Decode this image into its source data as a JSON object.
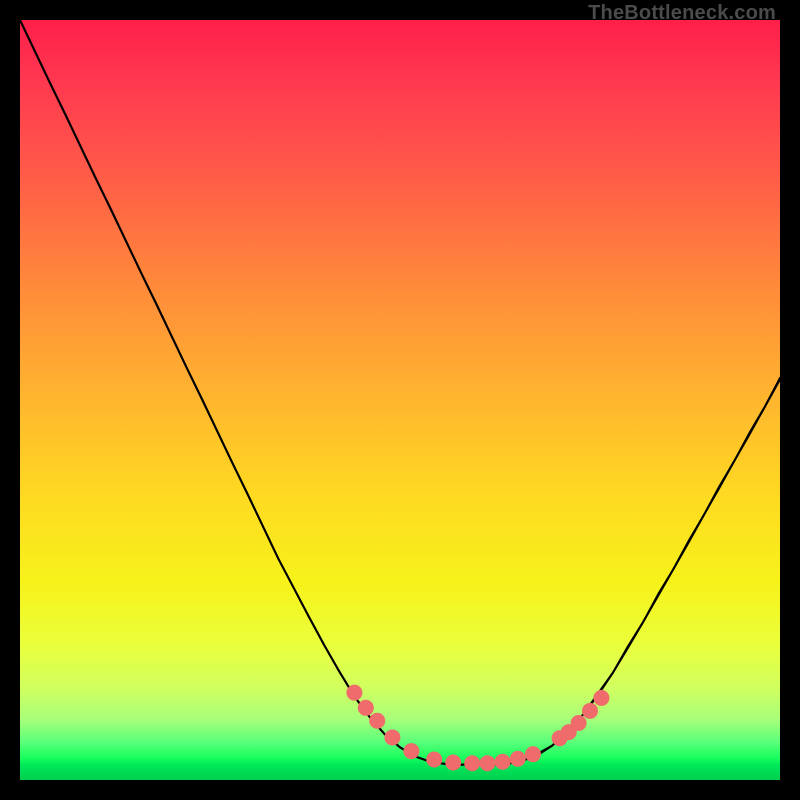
{
  "watermark": "TheBottleneck.com",
  "chart_data": {
    "type": "line",
    "title": "",
    "xlabel": "",
    "ylabel": "",
    "x": [
      0.0,
      0.02,
      0.04,
      0.06,
      0.08,
      0.1,
      0.12,
      0.14,
      0.16,
      0.18,
      0.2,
      0.22,
      0.24,
      0.26,
      0.28,
      0.3,
      0.32,
      0.34,
      0.36,
      0.38,
      0.4,
      0.42,
      0.44,
      0.46,
      0.48,
      0.5,
      0.52,
      0.54,
      0.56,
      0.58,
      0.6,
      0.62,
      0.64,
      0.66,
      0.68,
      0.7,
      0.72,
      0.74,
      0.76,
      0.78,
      0.8,
      0.82,
      0.84,
      0.86,
      0.88,
      0.9,
      0.92,
      0.94,
      0.96,
      0.98,
      1.0
    ],
    "series": [
      {
        "name": "curve",
        "values": [
          1.0,
          0.958,
          0.916,
          0.875,
          0.833,
          0.791,
          0.75,
          0.708,
          0.666,
          0.625,
          0.583,
          0.541,
          0.5,
          0.458,
          0.416,
          0.375,
          0.333,
          0.291,
          0.253,
          0.215,
          0.178,
          0.143,
          0.11,
          0.083,
          0.06,
          0.043,
          0.031,
          0.024,
          0.021,
          0.02,
          0.02,
          0.02,
          0.021,
          0.025,
          0.032,
          0.045,
          0.062,
          0.085,
          0.111,
          0.141,
          0.174,
          0.208,
          0.243,
          0.278,
          0.313,
          0.349,
          0.384,
          0.42,
          0.455,
          0.491,
          0.527
        ]
      },
      {
        "name": "curve-jitter-overlay",
        "values": [
          1.0,
          0.958,
          0.916,
          0.875,
          0.833,
          0.791,
          0.75,
          0.708,
          0.666,
          0.625,
          0.583,
          0.541,
          0.5,
          0.458,
          0.416,
          0.375,
          0.333,
          0.291,
          0.253,
          0.215,
          0.178,
          0.143,
          0.11,
          0.083,
          0.06,
          0.043,
          0.031,
          0.024,
          0.021,
          0.02,
          0.022,
          0.02,
          0.023,
          0.025,
          0.034,
          0.045,
          0.064,
          0.085,
          0.113,
          0.141,
          0.176,
          0.208,
          0.245,
          0.278,
          0.315,
          0.349,
          0.386,
          0.42,
          0.457,
          0.491,
          0.529
        ]
      }
    ],
    "markers": {
      "name": "valley-dots",
      "color": "#f06b6b",
      "radius_px": 8,
      "points": [
        {
          "x": 0.44,
          "y": 0.115
        },
        {
          "x": 0.455,
          "y": 0.095
        },
        {
          "x": 0.47,
          "y": 0.078
        },
        {
          "x": 0.49,
          "y": 0.056
        },
        {
          "x": 0.515,
          "y": 0.038
        },
        {
          "x": 0.545,
          "y": 0.027
        },
        {
          "x": 0.57,
          "y": 0.023
        },
        {
          "x": 0.595,
          "y": 0.022
        },
        {
          "x": 0.615,
          "y": 0.022
        },
        {
          "x": 0.635,
          "y": 0.024
        },
        {
          "x": 0.655,
          "y": 0.028
        },
        {
          "x": 0.675,
          "y": 0.034
        },
        {
          "x": 0.71,
          "y": 0.055
        },
        {
          "x": 0.722,
          "y": 0.063
        },
        {
          "x": 0.735,
          "y": 0.075
        },
        {
          "x": 0.75,
          "y": 0.091
        },
        {
          "x": 0.765,
          "y": 0.108
        }
      ]
    },
    "xlim": [
      0,
      1
    ],
    "ylim": [
      0,
      1
    ],
    "grid": false,
    "legend": false
  },
  "colors": {
    "frame": "#000000",
    "curve": "#000000",
    "marker": "#f06b6b",
    "watermark": "#4b4b4b"
  }
}
